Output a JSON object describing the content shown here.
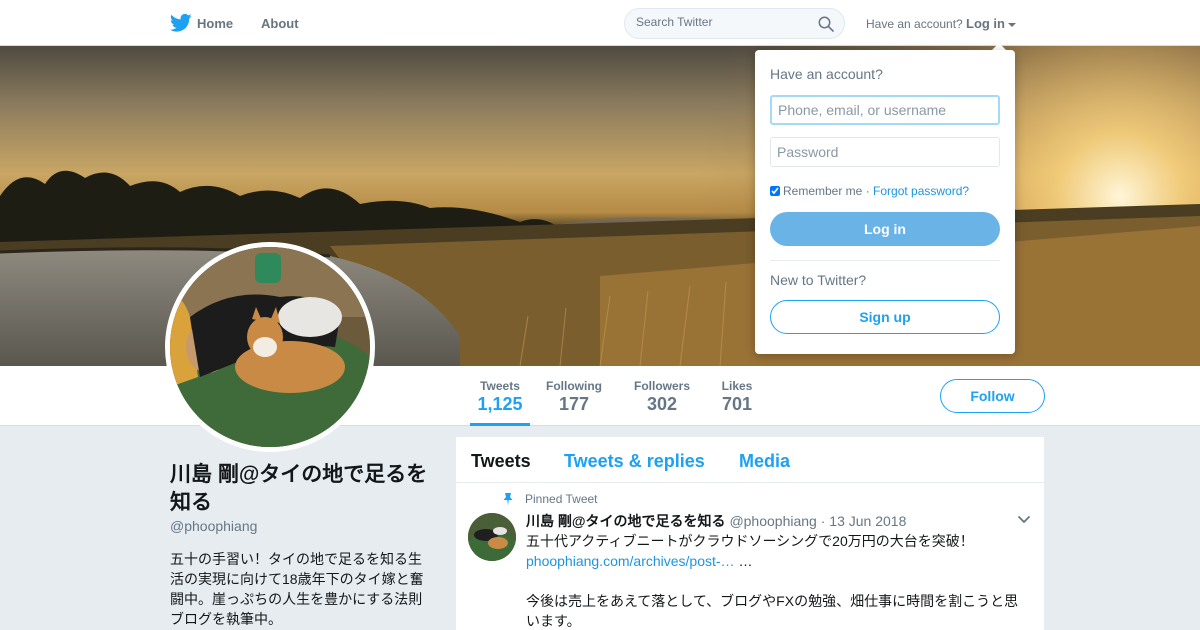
{
  "nav": {
    "home_label": "Home",
    "about_label": "About",
    "search_placeholder": "Search Twitter",
    "have_account_text": "Have an account?",
    "login_label": "Log in",
    "brand_color": "#1da1f2"
  },
  "profile": {
    "name": "川島 剛@タイの地で足るを知る",
    "handle": "@phoophiang",
    "bio": "五十の手習い！タイの地で足るを知る生活の実現に向けて18歳年下のタイ嫁と奮闘中。崖っぷちの人生を豊かにする法則ブログを執筆中。",
    "follow_label": "Follow"
  },
  "stats": [
    {
      "label": "Tweets",
      "value": "1,125"
    },
    {
      "label": "Following",
      "value": "177"
    },
    {
      "label": "Followers",
      "value": "302"
    },
    {
      "label": "Likes",
      "value": "701"
    }
  ],
  "timeline": {
    "tabs": [
      "Tweets",
      "Tweets & replies",
      "Media"
    ],
    "pinned_label": "Pinned Tweet",
    "tweet": {
      "name": "川島 剛@タイの地で足るを知る",
      "handle": "@phoophiang",
      "separator": "·",
      "date": "13 Jun 2018",
      "text_line1": "五十代アクティブニートがクラウドソーシングで20万円の大台を突破！",
      "link": "phoophiang.com/archives/post-…",
      "link_suffix": " …",
      "text_line2": "今後は売上をあえて落として、ブログやFXの勉強、畑仕事に時間を割こうと思います。"
    }
  },
  "login_dropdown": {
    "title": "Have an account?",
    "username_placeholder": "Phone, email, or username",
    "password_placeholder": "Password",
    "remember_label": "Remember me",
    "separator": " · ",
    "forgot_label": "Forgot password?",
    "login_button": "Log in",
    "new_to_label": "New to Twitter?",
    "signup_button": "Sign up"
  }
}
